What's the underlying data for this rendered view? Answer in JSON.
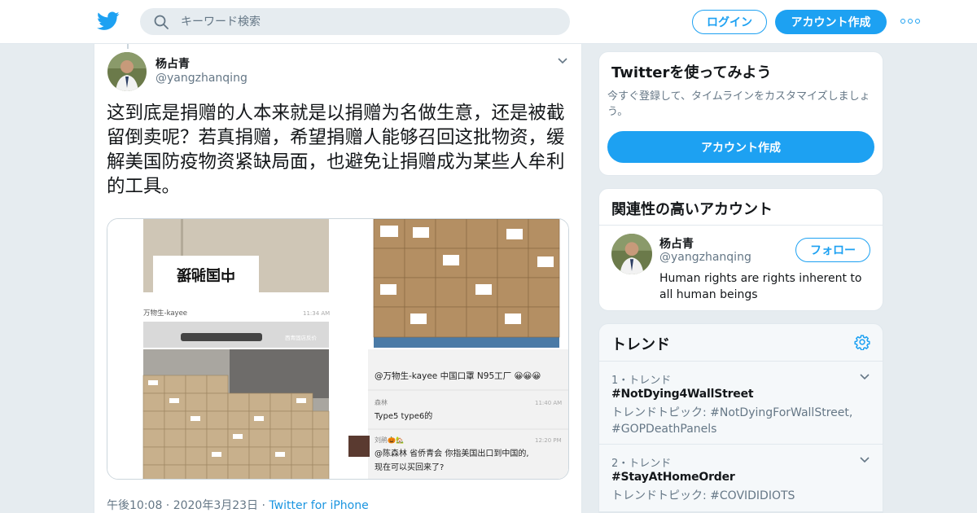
{
  "header": {
    "search_placeholder": "キーワード検索",
    "login_label": "ログイン",
    "signup_label": "アカウント作成"
  },
  "tweet": {
    "author_name": "杨占青",
    "author_handle": "@yangzhanqing",
    "text": "这到底是捐赠的人本来就是以捐赠为名做生意，还是被截留倒卖呢？若真捐赠，希望捐赠人能够召回这批物资，缓解美国防疫物资紧缺局面，也避免让捐赠成为某些人牟利的工具。",
    "timestamp": "午後10:08 · 2020年3月23日",
    "separator": " · ",
    "source": "Twitter for iPhone",
    "media": {
      "chat_top_name": "万物生-kayee",
      "chat_top_time": "11:34 AM",
      "chat_watermark": "西青固店反价",
      "chat_msg1": "@万物生-kayee 中国口罩 N95工厂 😀😀😀",
      "chat_name2": "森林",
      "chat_time2": "11:40 AM",
      "chat_msg2": "Type5   type6的",
      "chat_name3": "刘鹃🎃🏡",
      "chat_time3": "12:20 PM",
      "chat_msg3_line1": "@陈森林 省侨青会 你指美国出口到中国的,",
      "chat_msg3_line2": "现在可以买回来了?",
      "box_label": "中国驰援"
    }
  },
  "signup_card": {
    "title": "Twitterを使ってみよう",
    "description": "今すぐ登録して、タイムラインをカスタマイズしましょう。",
    "button_label": "アカウント作成"
  },
  "related_card": {
    "title": "関連性の高いアカウント",
    "name": "杨占青",
    "handle": "@yangzhanqing",
    "follow_label": "フォロー",
    "bio": "Human rights are rights inherent to all human beings"
  },
  "trends_card": {
    "title": "トレンド",
    "items": [
      {
        "rank": "1・トレンド",
        "tag": "#NotDying4WallStreet",
        "topics": "トレンドトピック: #NotDyingForWallStreet, #GOPDeathPanels"
      },
      {
        "rank": "2・トレンド",
        "tag": "#StayAtHomeOrder",
        "topics": "トレンドトピック: #COVIDIDIOTS"
      }
    ]
  },
  "colors": {
    "accent": "#1da1f2",
    "background": "#e6ecf0",
    "secondary_text": "#657786",
    "link": "#1b95e0"
  }
}
